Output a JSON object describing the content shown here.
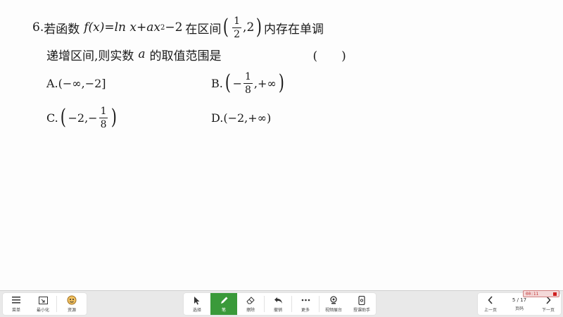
{
  "question": {
    "number": "6.",
    "stem_a": "若函数",
    "func": "f(x)=ln x+ax",
    "exp": "2",
    "func_tail": "−2",
    "stem_b": "在区间",
    "interval_num": "1",
    "interval_den": "2",
    "interval_end": ",2",
    "stem_c": "内存在单调",
    "line2_a": "递增区间,则实数",
    "line2_var": "a",
    "line2_b": "的取值范围是",
    "answer_blank": "(　　)"
  },
  "options": {
    "a_label": "A.",
    "a_text": "(−∞,−2]",
    "b_label": "B.",
    "b_pre": "−",
    "b_num": "1",
    "b_den": "8",
    "b_post": ",+∞",
    "c_label": "C.",
    "c_pre": "−2,−",
    "c_num": "1",
    "c_den": "8",
    "d_label": "D.",
    "d_text": "(−2,+∞)"
  },
  "toolbar": {
    "menu_label": "菜单",
    "minimize_label": "最小化",
    "resource_label": "资源",
    "select_label": "选择",
    "pen_label": "笔",
    "eraser_label": "擦除",
    "undo_label": "撤销",
    "more_label": "更多",
    "video_booth_label": "视频展台",
    "phone_label": "授课助手",
    "prev_label": "上一页",
    "page_indicator": "5 / 17",
    "page_label": "页码",
    "next_label": "下一页",
    "record_time": "00:11"
  },
  "colors": {
    "active_tool": "#3a9a3a",
    "record": "#d02020"
  },
  "icons": [
    "menu-icon",
    "minimize-icon",
    "resource-icon",
    "cursor-icon",
    "pen-icon",
    "eraser-icon",
    "undo-icon",
    "more-icon",
    "camera-icon",
    "phone-icon",
    "chevron-left-icon",
    "chevron-right-icon",
    "stop-icon"
  ]
}
